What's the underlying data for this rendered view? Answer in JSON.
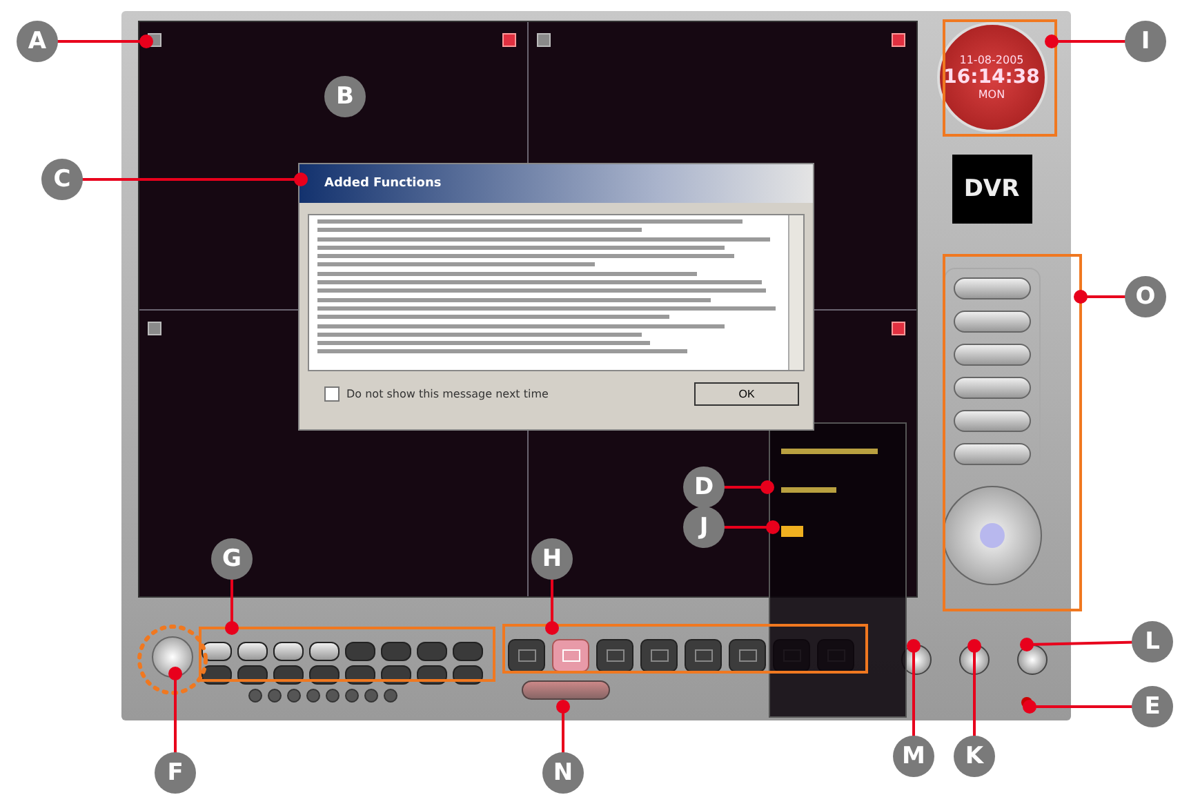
{
  "dialog": {
    "title": "Added Functions",
    "checkbox": {
      "label": "Do not show this message next time",
      "checked": false
    },
    "button": "OK"
  },
  "clock": {
    "date": "11-08-2005",
    "time": "16:14:38",
    "day": "MON"
  },
  "logo": "DVR",
  "layout_buttons": [
    {
      "selected": false
    },
    {
      "selected": true
    },
    {
      "selected": false
    },
    {
      "selected": false
    },
    {
      "selected": false
    },
    {
      "selected": false
    },
    {
      "selected": false
    },
    {
      "selected": false
    }
  ],
  "callouts": [
    {
      "letter": "A"
    },
    {
      "letter": "B"
    },
    {
      "letter": "C"
    },
    {
      "letter": "D"
    },
    {
      "letter": "E"
    },
    {
      "letter": "F"
    },
    {
      "letter": "G"
    },
    {
      "letter": "H"
    },
    {
      "letter": "I"
    },
    {
      "letter": "J"
    },
    {
      "letter": "K"
    },
    {
      "letter": "L"
    },
    {
      "letter": "M"
    },
    {
      "letter": "N"
    },
    {
      "letter": "O"
    }
  ]
}
